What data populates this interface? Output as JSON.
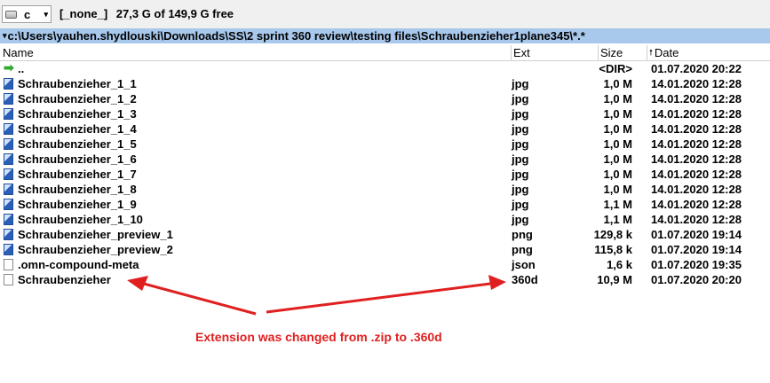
{
  "drivebar": {
    "drive_letter": "c",
    "dropdown_arrow": "▾",
    "volume_label": "[_none_]",
    "free_space": "27,3 G of 149,9 G free"
  },
  "pathbar": {
    "arrow": "▾",
    "path": "c:\\Users\\yauhen.shydlouski\\Downloads\\SS\\2 sprint 360 review\\testing files\\Schraubenzieher1plane345\\*.*"
  },
  "columns": {
    "name": "Name",
    "ext": "Ext",
    "size": "Size",
    "date": "Date",
    "sort_indicator": "🠕"
  },
  "files": [
    {
      "icon": "up-arrow-icon",
      "name": "..",
      "ext": "",
      "size": "<DIR>",
      "date": "01.07.2020 20:22"
    },
    {
      "icon": "image-file-icon",
      "name": "Schraubenzieher_1_1",
      "ext": "jpg",
      "size": "1,0 M",
      "date": "14.01.2020 12:28"
    },
    {
      "icon": "image-file-icon",
      "name": "Schraubenzieher_1_2",
      "ext": "jpg",
      "size": "1,0 M",
      "date": "14.01.2020 12:28"
    },
    {
      "icon": "image-file-icon",
      "name": "Schraubenzieher_1_3",
      "ext": "jpg",
      "size": "1,0 M",
      "date": "14.01.2020 12:28"
    },
    {
      "icon": "image-file-icon",
      "name": "Schraubenzieher_1_4",
      "ext": "jpg",
      "size": "1,0 M",
      "date": "14.01.2020 12:28"
    },
    {
      "icon": "image-file-icon",
      "name": "Schraubenzieher_1_5",
      "ext": "jpg",
      "size": "1,0 M",
      "date": "14.01.2020 12:28"
    },
    {
      "icon": "image-file-icon",
      "name": "Schraubenzieher_1_6",
      "ext": "jpg",
      "size": "1,0 M",
      "date": "14.01.2020 12:28"
    },
    {
      "icon": "image-file-icon",
      "name": "Schraubenzieher_1_7",
      "ext": "jpg",
      "size": "1,0 M",
      "date": "14.01.2020 12:28"
    },
    {
      "icon": "image-file-icon",
      "name": "Schraubenzieher_1_8",
      "ext": "jpg",
      "size": "1,0 M",
      "date": "14.01.2020 12:28"
    },
    {
      "icon": "image-file-icon",
      "name": "Schraubenzieher_1_9",
      "ext": "jpg",
      "size": "1,1 M",
      "date": "14.01.2020 12:28"
    },
    {
      "icon": "image-file-icon",
      "name": "Schraubenzieher_1_10",
      "ext": "jpg",
      "size": "1,1 M",
      "date": "14.01.2020 12:28"
    },
    {
      "icon": "image-file-icon",
      "name": "Schraubenzieher_preview_1",
      "ext": "png",
      "size": "129,8 k",
      "date": "01.07.2020 19:14"
    },
    {
      "icon": "image-file-icon",
      "name": "Schraubenzieher_preview_2",
      "ext": "png",
      "size": "115,8 k",
      "date": "01.07.2020 19:14"
    },
    {
      "icon": "file-icon",
      "name": ".omn-compound-meta",
      "ext": "json",
      "size": "1,6 k",
      "date": "01.07.2020 19:35"
    },
    {
      "icon": "file-icon",
      "name": "Schraubenzieher",
      "ext": "360d",
      "size": "10,9 M",
      "date": "01.07.2020 20:20"
    }
  ],
  "annotation": {
    "text": "Extension was changed from .zip to .360d",
    "color": "#e02020"
  },
  "colors": {
    "pathbar_bg": "#a8c8ec",
    "toolbar_bg": "#f0f0f0"
  }
}
